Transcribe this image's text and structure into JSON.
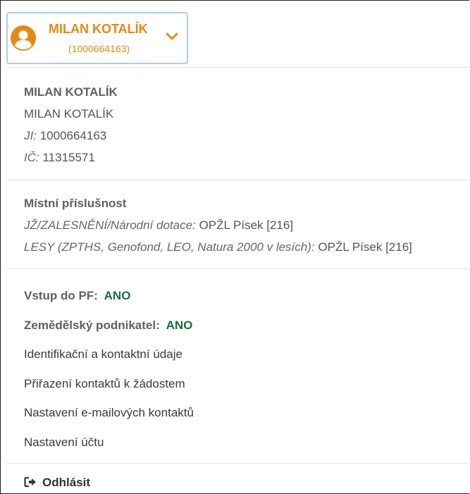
{
  "user": {
    "name": "MILAN KOTALÍK",
    "id_display": "(1000664163)"
  },
  "identity": {
    "title": "MILAN KOTALÍK",
    "name": "MILAN KOTALÍK",
    "ji_label": "JI:",
    "ji_value": "1000664163",
    "ic_label": "IČ:",
    "ic_value": "11315571"
  },
  "jurisdiction": {
    "title": "Místní příslušnost",
    "rows": [
      {
        "label": "JŽ/ZALESNĚNÍ/Národní dotace:",
        "value": "OPŽL Písek [216]"
      },
      {
        "label": "LESY (ZPTHS, Genofond, LEO, Natura 2000 v lesích):",
        "value": "OPŽL Písek [216]"
      }
    ]
  },
  "status": {
    "pf_label": "Vstup do PF:",
    "pf_value": "ANO",
    "farmer_label": "Zemědělský podnikatel:",
    "farmer_value": "ANO"
  },
  "menu": {
    "items": [
      "Identifikační a kontaktní údaje",
      "Přiřazení kontaktů k žádostem",
      "Nastavení e-mailových kontaktů",
      "Nastavení účtu"
    ]
  },
  "logout": {
    "label": "Odhlásit"
  },
  "colors": {
    "accent": "#e28a12",
    "positive": "#1c6b3f",
    "toggle_border": "#a9cdf0"
  },
  "icons": {
    "avatar": "user-circle-icon",
    "toggle": "chevron-down-icon",
    "logout": "sign-out-icon"
  }
}
